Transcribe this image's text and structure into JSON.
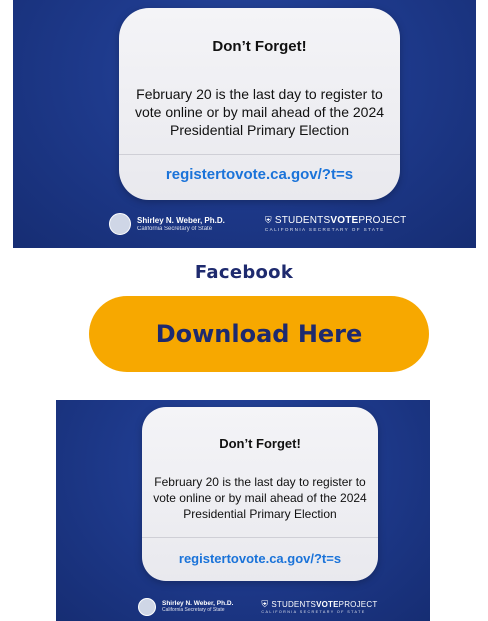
{
  "banner_1": {
    "card": {
      "title": "Don’t Forget!",
      "body": "February 20 is the last day to register to vote online or by mail ahead of the 2024 Presidential Primary Election",
      "link": "registertovote.ca.gov/?t=s"
    },
    "footer": {
      "seal_icon": "california-seal-icon",
      "sos_name": "Shirley N. Weber, Ph.D.",
      "sos_title": "California Secretary of State",
      "project_prefix": "STUDENTS",
      "project_bold": "VOTE",
      "project_suffix": "PROJECT",
      "project_tagline": "CALIFORNIA SECRETARY OF STATE"
    }
  },
  "platform_label": "Facebook",
  "download_button": {
    "label": "Download Here"
  },
  "banner_2": {
    "card": {
      "title": "Don’t Forget!",
      "body": "February 20 is the last day to register to vote online or by mail ahead of the 2024 Presidential Primary Election",
      "link": "registertovote.ca.gov/?t=s"
    },
    "footer": {
      "seal_icon": "california-seal-icon",
      "sos_name": "Shirley N. Weber, Ph.D.",
      "sos_title": "California Secretary of State",
      "project_prefix": "STUDENTS",
      "project_bold": "VOTE",
      "project_suffix": "PROJECT",
      "project_tagline": "CALIFORNIA SECRETARY OF STATE"
    }
  },
  "colors": {
    "banner_bg": "#1e3a8c",
    "button_bg": "#f7a800",
    "heading_text": "#1e2a6e",
    "link_text": "#1a73d9"
  }
}
